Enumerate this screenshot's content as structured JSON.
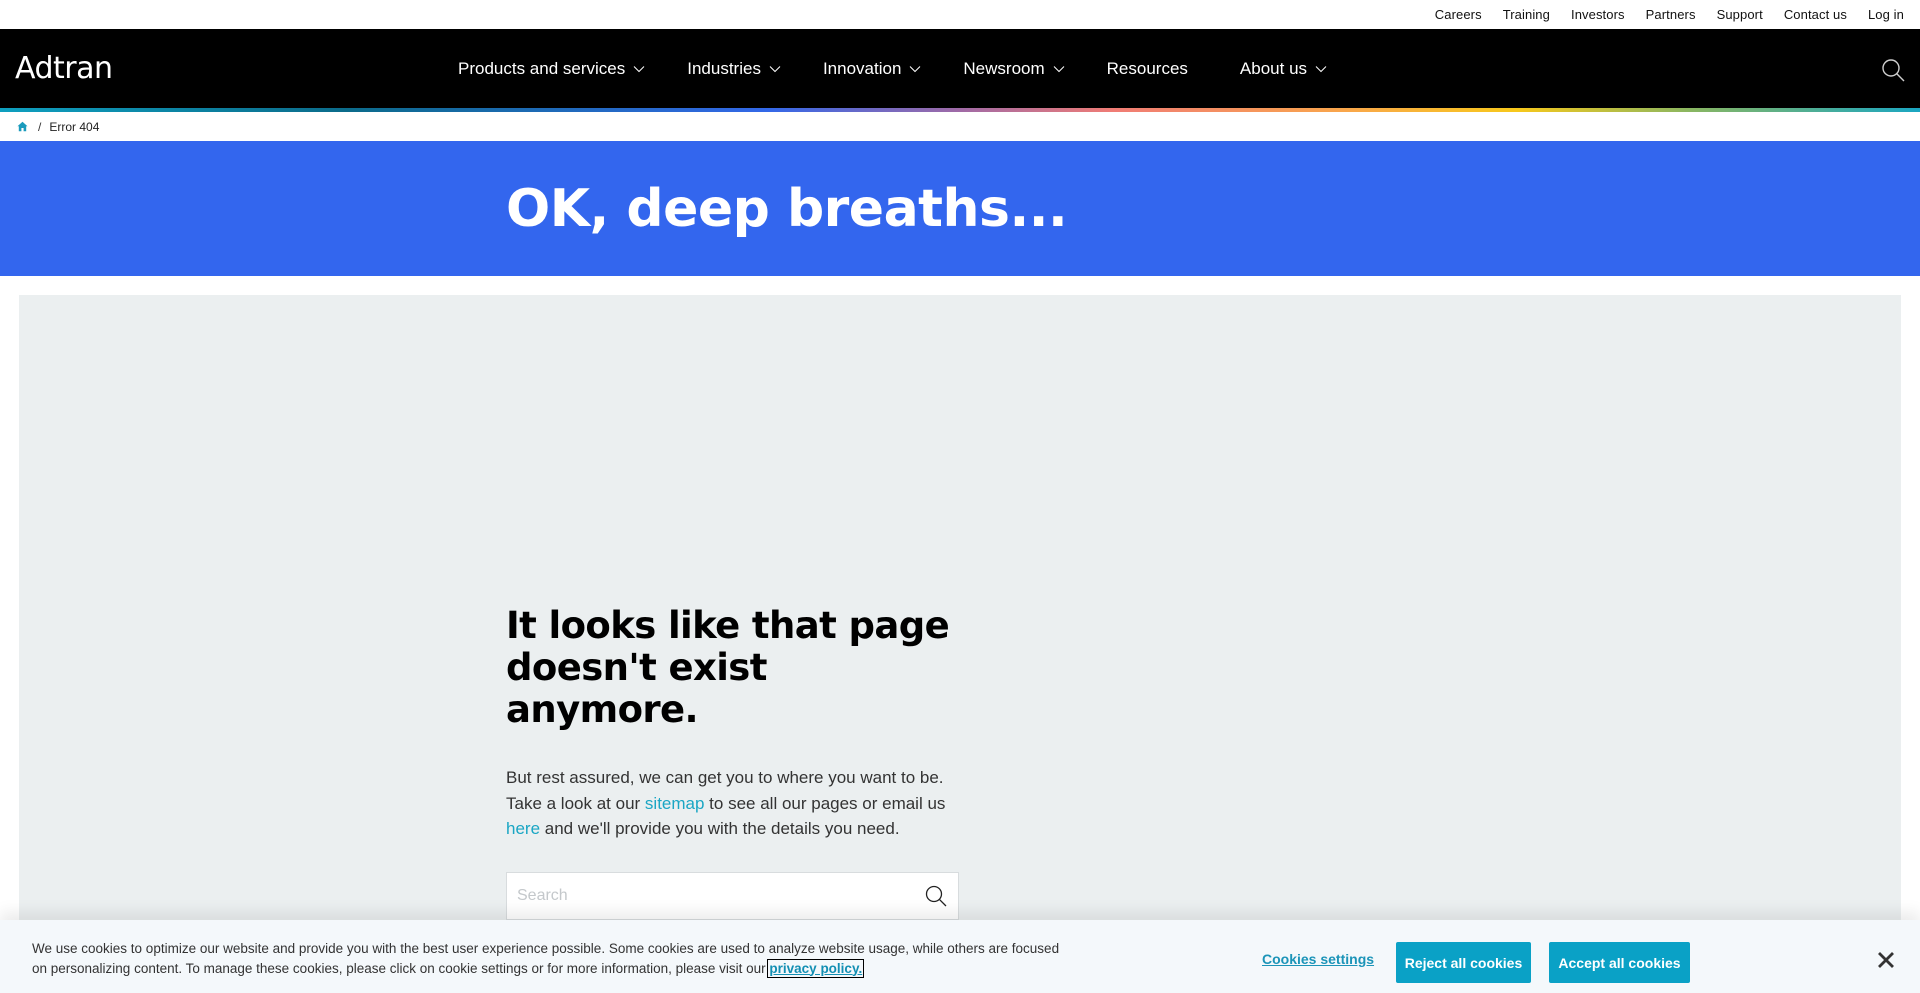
{
  "utility_nav": [
    "Careers",
    "Training",
    "Investors",
    "Partners",
    "Support",
    "Contact us",
    "Log in"
  ],
  "brand": {
    "logo_text": "Adtran"
  },
  "main_nav": [
    {
      "label": "Products and services",
      "has_dropdown": true
    },
    {
      "label": "Industries",
      "has_dropdown": true
    },
    {
      "label": "Innovation",
      "has_dropdown": true
    },
    {
      "label": "Newsroom",
      "has_dropdown": true
    },
    {
      "label": "Resources",
      "has_dropdown": false
    },
    {
      "label": "About us",
      "has_dropdown": true
    }
  ],
  "icons": {
    "nav_search": "search-icon",
    "breadcrumb_home": "home-icon",
    "dropdown": "chevron-down-icon",
    "close": "close-icon"
  },
  "breadcrumb": {
    "separator": "/",
    "current": "Error 404"
  },
  "hero": {
    "title": "OK, deep breaths..."
  },
  "error": {
    "heading": "It looks like that page doesn't exist anymore.",
    "body_part1": "But rest assured, we can get you to where you want to be. Take a look at our ",
    "sitemap_link": "sitemap",
    "body_part2": " to see all our pages or email us ",
    "here_link": "here",
    "body_part3": " and we'll provide you with the details you need.",
    "search_placeholder": "Search",
    "search_value": ""
  },
  "cookie_banner": {
    "text": "We use cookies to optimize our website and provide you with the best user experience possible. Some cookies are used to analyze website usage, while others are focused on personalizing content. To manage these cookies, please click on cookie settings or for more information, please visit our ",
    "privacy_link": "privacy policy.",
    "settings_label": "Cookies settings",
    "reject_label": "Reject all cookies",
    "accept_label": "Accept all cookies"
  },
  "colors": {
    "hero_blue": "#3366ee",
    "accent_teal": "#0aa1c6",
    "panel_gray": "#ebeff0",
    "nav_black": "#000000"
  }
}
